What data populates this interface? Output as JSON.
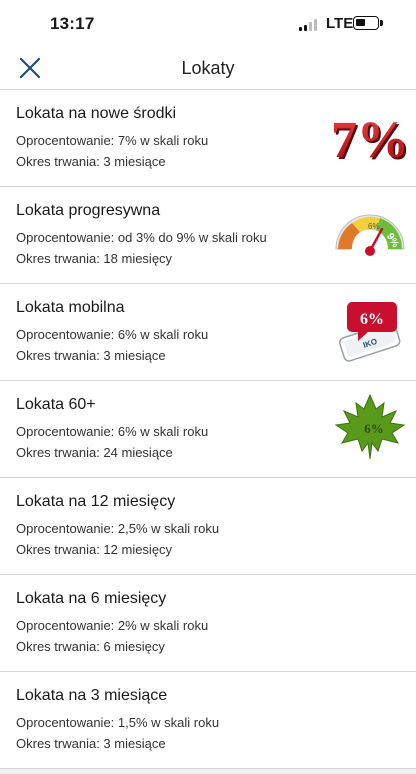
{
  "status": {
    "time": "13:17",
    "network": "LTE"
  },
  "nav": {
    "title": "Lokaty"
  },
  "deposits": [
    {
      "title": "Lokata na nowe środki",
      "rate": "Oprocentowanie: 7% w skali roku",
      "term": "Okres trwania: 3 miesiące",
      "badge": "7%",
      "icon": "red-7-percent-icon"
    },
    {
      "title": "Lokata progresywna",
      "rate": "Oprocentowanie: od 3% do 9% w skali roku",
      "term": "Okres trwania: 18 miesięcy",
      "badge_low": "6%",
      "badge_high": "9%",
      "icon": "gauge-icon"
    },
    {
      "title": "Lokata mobilna",
      "rate": "Oprocentowanie: 6% w skali roku",
      "term": "Okres trwania: 3 miesiące",
      "badge": "6%",
      "badge_sub": "IKO",
      "icon": "phone-bubble-icon"
    },
    {
      "title": "Lokata 60+",
      "rate": "Oprocentowanie: 6% w skali roku",
      "term": "Okres trwania: 24 miesiące",
      "badge": "6%",
      "icon": "maple-leaf-icon"
    },
    {
      "title": "Lokata na 12 miesięcy",
      "rate": "Oprocentowanie: 2,5% w skali roku",
      "term": "Okres trwania: 12 miesięcy"
    },
    {
      "title": "Lokata na 6 miesięcy",
      "rate": "Oprocentowanie: 2% w skali roku",
      "term": "Okres trwania: 6 miesięcy"
    },
    {
      "title": "Lokata na 3 miesiące",
      "rate": "Oprocentowanie: 1,5% w skali roku",
      "term": "Okres trwania: 3 miesiące"
    }
  ],
  "colors": {
    "accent": "#1f4e79",
    "separator": "#d6d6d6",
    "badge_red": "#c8102e",
    "leaf_green": "#5a9a1a"
  }
}
